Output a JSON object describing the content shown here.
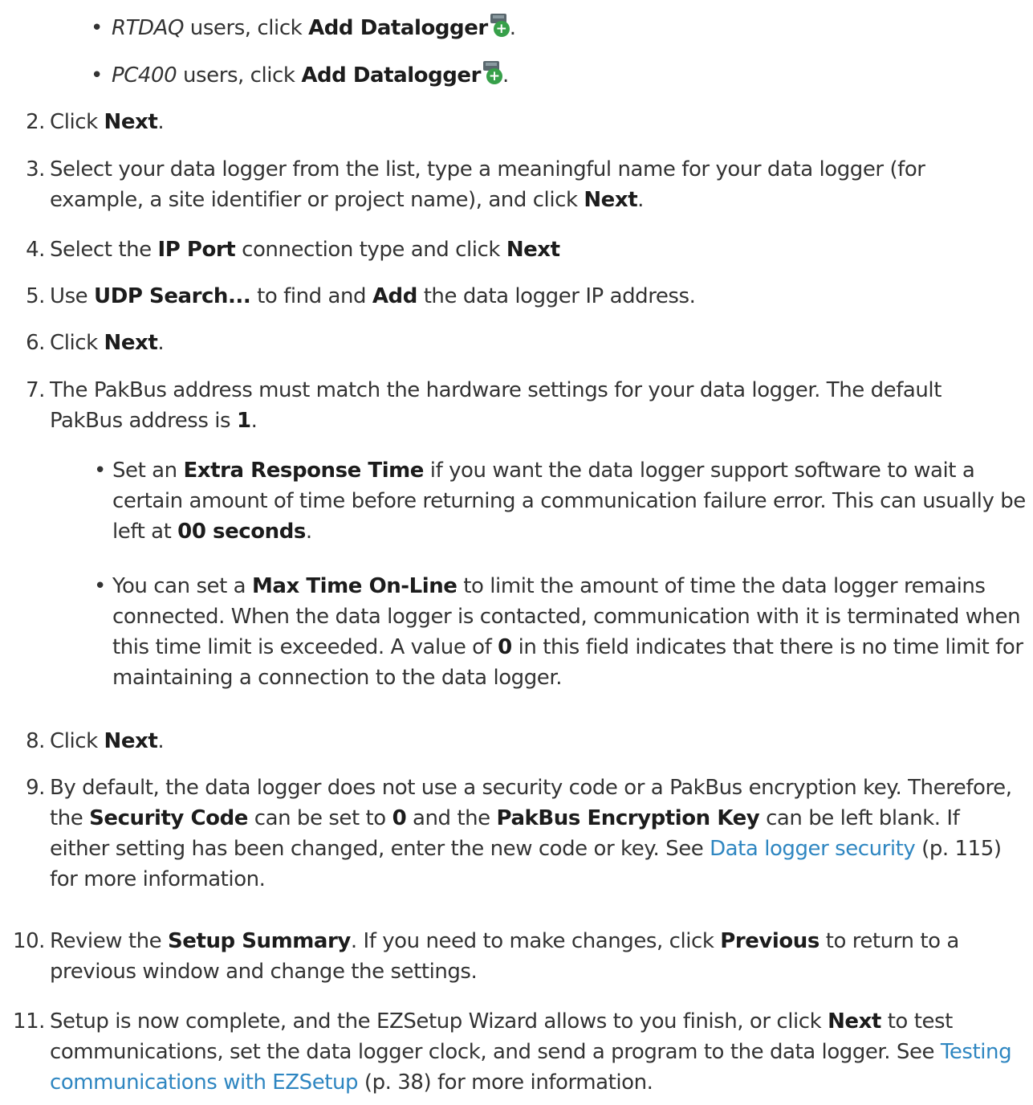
{
  "substeps": [
    {
      "app": "RTDAQ",
      "pre": " users, click ",
      "bold": "Add Datalogger",
      "post": "."
    },
    {
      "app": "PC400",
      "pre": " users, click ",
      "bold": "Add Datalogger",
      "post": "."
    }
  ],
  "steps": {
    "s2": {
      "num": "2.",
      "t1": "Click ",
      "b1": "Next",
      "t2": "."
    },
    "s3": {
      "num": "3.",
      "t1": "Select your data logger from the list, type a meaningful name for your data logger (for example, a site identifier or project name), and click ",
      "b1": "Next",
      "t2": "."
    },
    "s4": {
      "num": "4.",
      "t1": "Select the ",
      "b1": "IP Port",
      "t2": " connection type and click ",
      "b2": "Next"
    },
    "s5": {
      "num": "5.",
      "t1": "Use ",
      "b1": "UDP Search...",
      "t2": " to find and ",
      "b2": "Add",
      "t3": " the data logger IP address."
    },
    "s6": {
      "num": "6.",
      "t1": "Click ",
      "b1": "Next",
      "t2": "."
    },
    "s7": {
      "num": "7.",
      "t1": "The PakBus address must match the hardware settings for your data logger. The default PakBus address is ",
      "b1": "1",
      "t2": "."
    },
    "s8": {
      "num": "8.",
      "t1": "Click ",
      "b1": "Next",
      "t2": "."
    },
    "s9": {
      "num": "9.",
      "t1": "By default, the data logger does not use a security code or a PakBus encryption key. Therefore, the ",
      "b1": "Security Code",
      "t2": " can be set to ",
      "b2": "0",
      "t3": " and the ",
      "b3": "PakBus Encryption Key",
      "t4": " can be left blank. If either setting has been changed, enter the new code or key. See ",
      "link": "Data logger security",
      "t5": " (p. 115) for more information."
    },
    "s10": {
      "num": "10.",
      "t1": "Review the ",
      "b1": "Setup Summary",
      "t2": ". If you need to make changes, click ",
      "b2": "Previous",
      "t3": " to return to a previous window and change the settings."
    },
    "s11": {
      "num": "11.",
      "t1": "Setup is now complete, and the EZSetup Wizard allows to you finish, or click ",
      "b1": "Next",
      "t2": " to test communications, set the data logger clock, and send a program to the data logger. See ",
      "link": "Testing communications with EZSetup",
      "t3": " (p. 38) for more information."
    }
  },
  "bullets": {
    "b1": {
      "t1": "Set an ",
      "b1": "Extra Response Time",
      "t2": " if you want the data logger support software to wait a certain amount of time before returning a communication failure error. This can usually be left at ",
      "b2": "00 seconds",
      "t3": "."
    },
    "b2": {
      "t1": "You can set a ",
      "b1": "Max Time On-Line",
      "t2": " to limit the amount of time the data logger remains connected. When the data logger is contacted, communication with it is terminated when this time limit is exceeded. A value of ",
      "b2": "0",
      "t3": " in this field indicates that there is no time limit for maintaining a connection to the data logger."
    }
  },
  "icons": {
    "add_datalogger": "add-datalogger-icon"
  },
  "colors": {
    "text": "#333333",
    "link": "#2e86c1",
    "icon_green": "#37a04a"
  }
}
